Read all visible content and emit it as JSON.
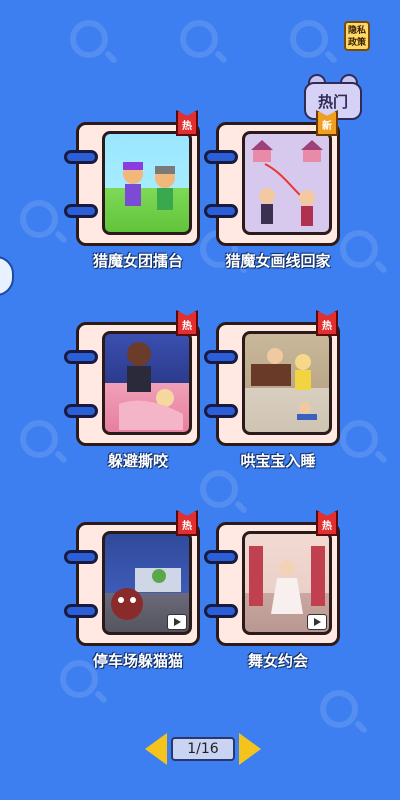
{
  "privacy": {
    "label": "隐私\n政策"
  },
  "hot_button": {
    "label": "热门"
  },
  "games": [
    {
      "title": "猎魔女团擂台",
      "tag": "热",
      "tag_type": "hot",
      "has_video": false
    },
    {
      "title": "猎魔女画线回家",
      "tag": "新",
      "tag_type": "new",
      "has_video": false
    },
    {
      "title": "躲避撕咬",
      "tag": "热",
      "tag_type": "hot",
      "has_video": false
    },
    {
      "title": "哄宝宝入睡",
      "tag": "热",
      "tag_type": "hot",
      "has_video": false
    },
    {
      "title": "停车场躲猫猫",
      "tag": "热",
      "tag_type": "hot",
      "has_video": true
    },
    {
      "title": "舞女约会",
      "tag": "热",
      "tag_type": "hot",
      "has_video": true
    }
  ],
  "pagination": {
    "current": "1/16"
  },
  "icons": {
    "prev": "arrow-left-icon",
    "next": "arrow-right-icon",
    "play": "video-play-icon"
  },
  "colors": {
    "background": "#3d7ff0",
    "hot_tag": "#e23030",
    "new_tag": "#f0a020",
    "arrows": "#f5c41c"
  }
}
